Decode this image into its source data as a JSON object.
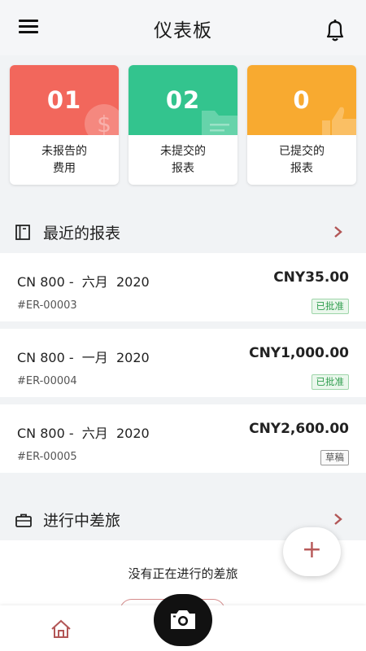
{
  "header": {
    "title": "仪表板",
    "icons": [
      "menu-icon",
      "bell-icon"
    ]
  },
  "summary_cards": [
    {
      "count": "01",
      "label_line1": "未报告的",
      "label_line2": "费用",
      "color": "#f2675c",
      "icon": "dollar-icon"
    },
    {
      "count": "02",
      "label_line1": "未提交的",
      "label_line2": "报表",
      "color": "#33c48e",
      "icon": "folder-icon"
    },
    {
      "count": "0",
      "label_line1": "已提交的",
      "label_line2": "报表",
      "color": "#f8aa30",
      "icon": "thumbs-up-icon"
    }
  ],
  "recent_reports": {
    "title": "最近的报表",
    "items": [
      {
        "name": "CN 800 -  六月  2020",
        "amount": "CNY35.00",
        "id": "#ER-00003",
        "status": "已批准"
      },
      {
        "name": "CN 800 -  一月  2020",
        "amount": "CNY1,000.00",
        "id": "#ER-00004",
        "status": "已批准"
      },
      {
        "name": "CN 800 -  六月  2020",
        "amount": "CNY2,600.00",
        "id": "#ER-00005",
        "status": "草稿"
      }
    ]
  },
  "trips": {
    "title": "进行中差旅",
    "empty_text": "没有正在进行的差旅"
  },
  "fab": {
    "label": "+"
  },
  "colors": {
    "background": "#f1f3f5",
    "accent": "#b85a5a",
    "approved": "#2e9d4d"
  }
}
